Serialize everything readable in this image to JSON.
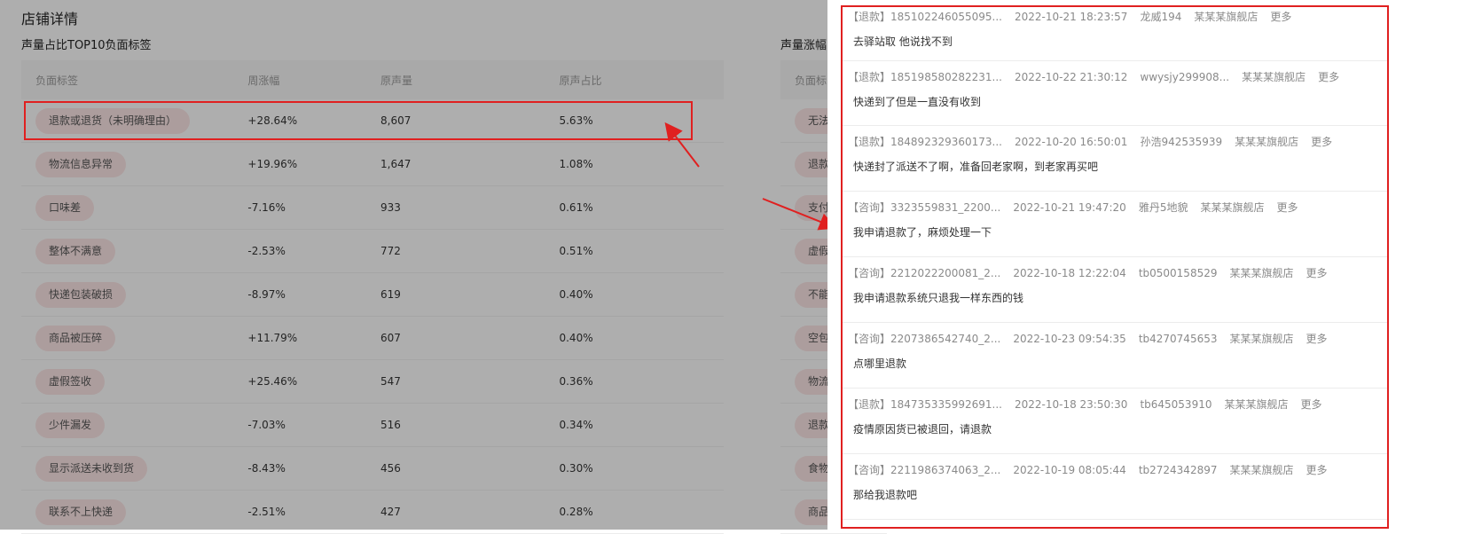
{
  "page_title": "店铺详情",
  "left_section": {
    "title": "声量占比TOP10负面标签",
    "headers": [
      "负面标签",
      "周涨幅",
      "原声量",
      "原声占比"
    ],
    "rows": [
      {
        "tag": "退款或退货（未明确理由）",
        "change": "+28.64%",
        "volume": "8,607",
        "ratio": "5.63%"
      },
      {
        "tag": "物流信息异常",
        "change": "+19.96%",
        "volume": "1,647",
        "ratio": "1.08%"
      },
      {
        "tag": "口味差",
        "change": "-7.16%",
        "volume": "933",
        "ratio": "0.61%"
      },
      {
        "tag": "整体不满意",
        "change": "-2.53%",
        "volume": "772",
        "ratio": "0.51%"
      },
      {
        "tag": "快递包装破损",
        "change": "-8.97%",
        "volume": "619",
        "ratio": "0.40%"
      },
      {
        "tag": "商品被压碎",
        "change": "+11.79%",
        "volume": "607",
        "ratio": "0.40%"
      },
      {
        "tag": "虚假签收",
        "change": "+25.46%",
        "volume": "547",
        "ratio": "0.36%"
      },
      {
        "tag": "少件漏发",
        "change": "-7.03%",
        "volume": "516",
        "ratio": "0.34%"
      },
      {
        "tag": "显示派送未收到货",
        "change": "-8.43%",
        "volume": "456",
        "ratio": "0.30%"
      },
      {
        "tag": "联系不上快递",
        "change": "-2.51%",
        "volume": "427",
        "ratio": "0.28%"
      }
    ]
  },
  "right_section": {
    "title": "声量涨幅",
    "header": "负面标",
    "tags": [
      "无法",
      "退款",
      "支付",
      "虚假",
      "不能",
      "空包",
      "物流",
      "退款",
      "食物",
      "商品"
    ]
  },
  "drawer": {
    "more_label": "更多",
    "messages": [
      {
        "type": "【退款】",
        "id": "185102246055095...",
        "time": "2022-10-21 18:23:57",
        "user": "龙威194",
        "shop": "某某某旗舰店",
        "text": "去驿站取 他说找不到"
      },
      {
        "type": "【退款】",
        "id": "185198580282231...",
        "time": "2022-10-22 21:30:12",
        "user": "wwysjy299908...",
        "shop": "某某某旗舰店",
        "text": "快递到了但是一直没有收到"
      },
      {
        "type": "【退款】",
        "id": "184892329360173...",
        "time": "2022-10-20 16:50:01",
        "user": "孙浩942535939",
        "shop": "某某某旗舰店",
        "text": "快递封了派送不了啊，准备回老家啊，到老家再买吧"
      },
      {
        "type": "【咨询】",
        "id": "3323559831_2200...",
        "time": "2022-10-21 19:47:20",
        "user": "雅丹5地貌",
        "shop": "某某某旗舰店",
        "text": "我申请退款了，麻烦处理一下"
      },
      {
        "type": "【咨询】",
        "id": "2212022200081_2...",
        "time": "2022-10-18 12:22:04",
        "user": "tb0500158529",
        "shop": "某某某旗舰店",
        "text": "我申请退款系统只退我一样东西的钱"
      },
      {
        "type": "【咨询】",
        "id": "2207386542740_2...",
        "time": "2022-10-23 09:54:35",
        "user": "tb4270745653",
        "shop": "某某某旗舰店",
        "text": "点哪里退款"
      },
      {
        "type": "【退款】",
        "id": "184735335992691...",
        "time": "2022-10-18 23:50:30",
        "user": "tb645053910",
        "shop": "某某某旗舰店",
        "text": "疫情原因货已被退回，请退款"
      },
      {
        "type": "【咨询】",
        "id": "2211986374063_2...",
        "time": "2022-10-19 08:05:44",
        "user": "tb2724342897",
        "shop": "某某某旗舰店",
        "text": "那给我退款吧"
      }
    ]
  },
  "colors": {
    "highlight": "#e02020",
    "tag_bg": "#f6e1e1"
  }
}
